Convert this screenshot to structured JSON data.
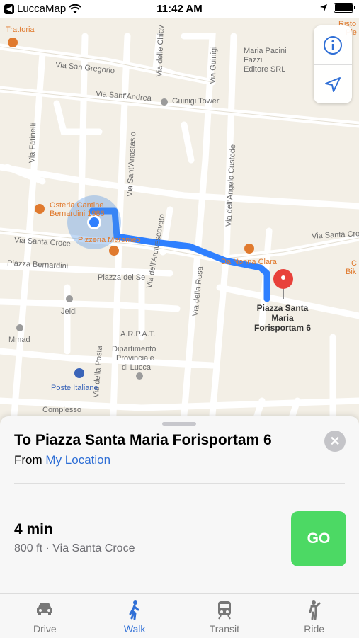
{
  "status_bar": {
    "back_app": "LuccaMap",
    "time": "11:42 AM",
    "battery_level": 0.95
  },
  "map": {
    "street_labels": [
      "Trattoria",
      "Via San Gregorio",
      "Via Sant'Andrea",
      "Guinigi Tower",
      "Via Fatinelli",
      "Via Sant'Anastasio",
      "Via delle Chiav",
      "Via Guinigi",
      "Via dell'Angelo Custode",
      "Maria Pacini",
      "Fazzi",
      "Editore SRL",
      "Via Santa Croce",
      "Piazza Bernardini",
      "Piazza dei Se",
      "Jeidi",
      "Mmad",
      "A.R.P.A.T.",
      "Dipartimento",
      "Provinciale",
      "di Lucca",
      "Complesso",
      "Via dell'Arcivescovato",
      "Via della Rosa",
      "Via della Posta",
      "Via Santa Cro",
      "Via Guinigi",
      "Risto",
      "Pie",
      "C",
      "Bik"
    ],
    "poi_orange": [
      "Osteria Cantine",
      "Bernardini 1986",
      "Pizzeria Marameo",
      "Da Nonna Clara"
    ],
    "poi_blue": "Poste Italiane",
    "destination_pin": [
      "Piazza Santa",
      "Maria",
      "Forisportam 6"
    ],
    "route_color": "#2f80ff",
    "pin_color": "#e8413a"
  },
  "controls": {
    "info_icon": "info-icon",
    "location_icon": "location-arrow-icon"
  },
  "sheet": {
    "title": "To Piazza Santa Maria Forisportam 6",
    "from_label": "From",
    "from_link": "My Location",
    "close_glyph": "✕",
    "duration": "4 min",
    "detail": "800 ft · Via Santa Croce",
    "go_label": "GO"
  },
  "tabs": [
    {
      "label": "Drive",
      "icon": "car-icon",
      "active": false
    },
    {
      "label": "Walk",
      "icon": "walk-icon",
      "active": true
    },
    {
      "label": "Transit",
      "icon": "train-icon",
      "active": false
    },
    {
      "label": "Ride",
      "icon": "ride-icon",
      "active": false
    }
  ],
  "colors": {
    "accent": "#2f6fd6",
    "go": "#4cd964",
    "poi": "#e07a2e"
  }
}
